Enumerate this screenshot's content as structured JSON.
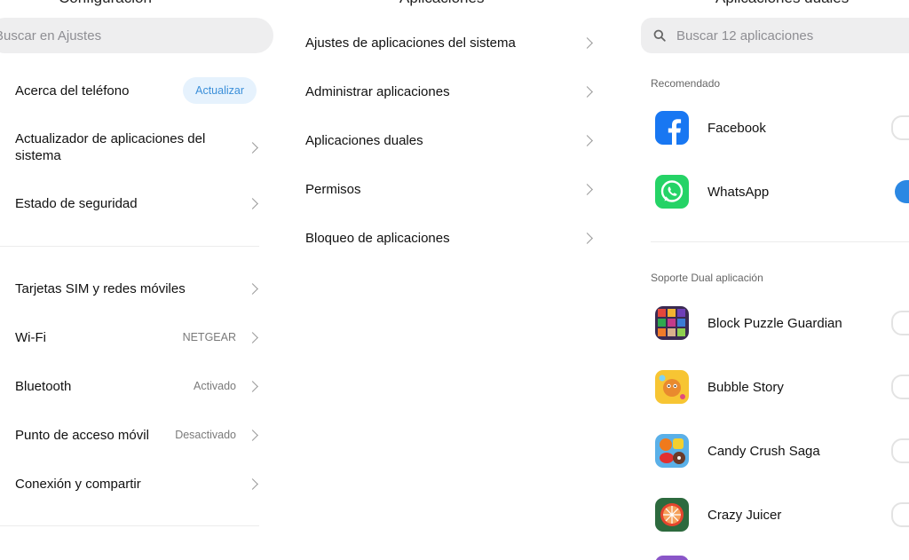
{
  "settings": {
    "title_fragment": "Configuración",
    "search_placeholder": "Buscar en Ajustes",
    "about": {
      "label": "Acerca del teléfono",
      "badge": "Actualizar"
    },
    "updater": {
      "label": "Actualizador de aplicaciones del sistema"
    },
    "security": {
      "label": "Estado de seguridad"
    },
    "items": [
      {
        "label": "Tarjetas SIM y redes móviles",
        "value": ""
      },
      {
        "label": "Wi-Fi",
        "value": "NETGEAR"
      },
      {
        "label": "Bluetooth",
        "value": "Activado"
      },
      {
        "label": "Punto de acceso móvil",
        "value": "Desactivado"
      },
      {
        "label": "Conexión y compartir",
        "value": ""
      }
    ]
  },
  "apps": {
    "title": "Aplicaciones",
    "items": [
      {
        "label": "Ajustes de aplicaciones del sistema"
      },
      {
        "label": "Administrar aplicaciones"
      },
      {
        "label": "Aplicaciones duales"
      },
      {
        "label": "Permisos"
      },
      {
        "label": "Bloqueo de aplicaciones"
      }
    ]
  },
  "dual": {
    "title": "Aplicaciones duales",
    "search_placeholder": "Buscar 12 aplicaciones",
    "recommended_label": "Recomendado",
    "recommended": [
      {
        "name": "Facebook",
        "icon": "facebook-icon",
        "enabled": false
      },
      {
        "name": "WhatsApp",
        "icon": "whatsapp-icon",
        "enabled": true
      }
    ],
    "support_label": "Soporte Dual aplicación",
    "support": [
      {
        "name": "Block Puzzle Guardian",
        "icon": "block-puzzle-icon",
        "enabled": false
      },
      {
        "name": "Bubble Story",
        "icon": "bubble-story-icon",
        "enabled": false
      },
      {
        "name": "Candy Crush Saga",
        "icon": "candy-crush-icon",
        "enabled": false
      },
      {
        "name": "Crazy Juicer",
        "icon": "crazy-juicer-icon",
        "enabled": false
      }
    ]
  },
  "colors": {
    "accent": "#2b88e3",
    "badge_bg": "#e6f2fd",
    "facebook": "#1877f2",
    "whatsapp": "#25d366"
  }
}
